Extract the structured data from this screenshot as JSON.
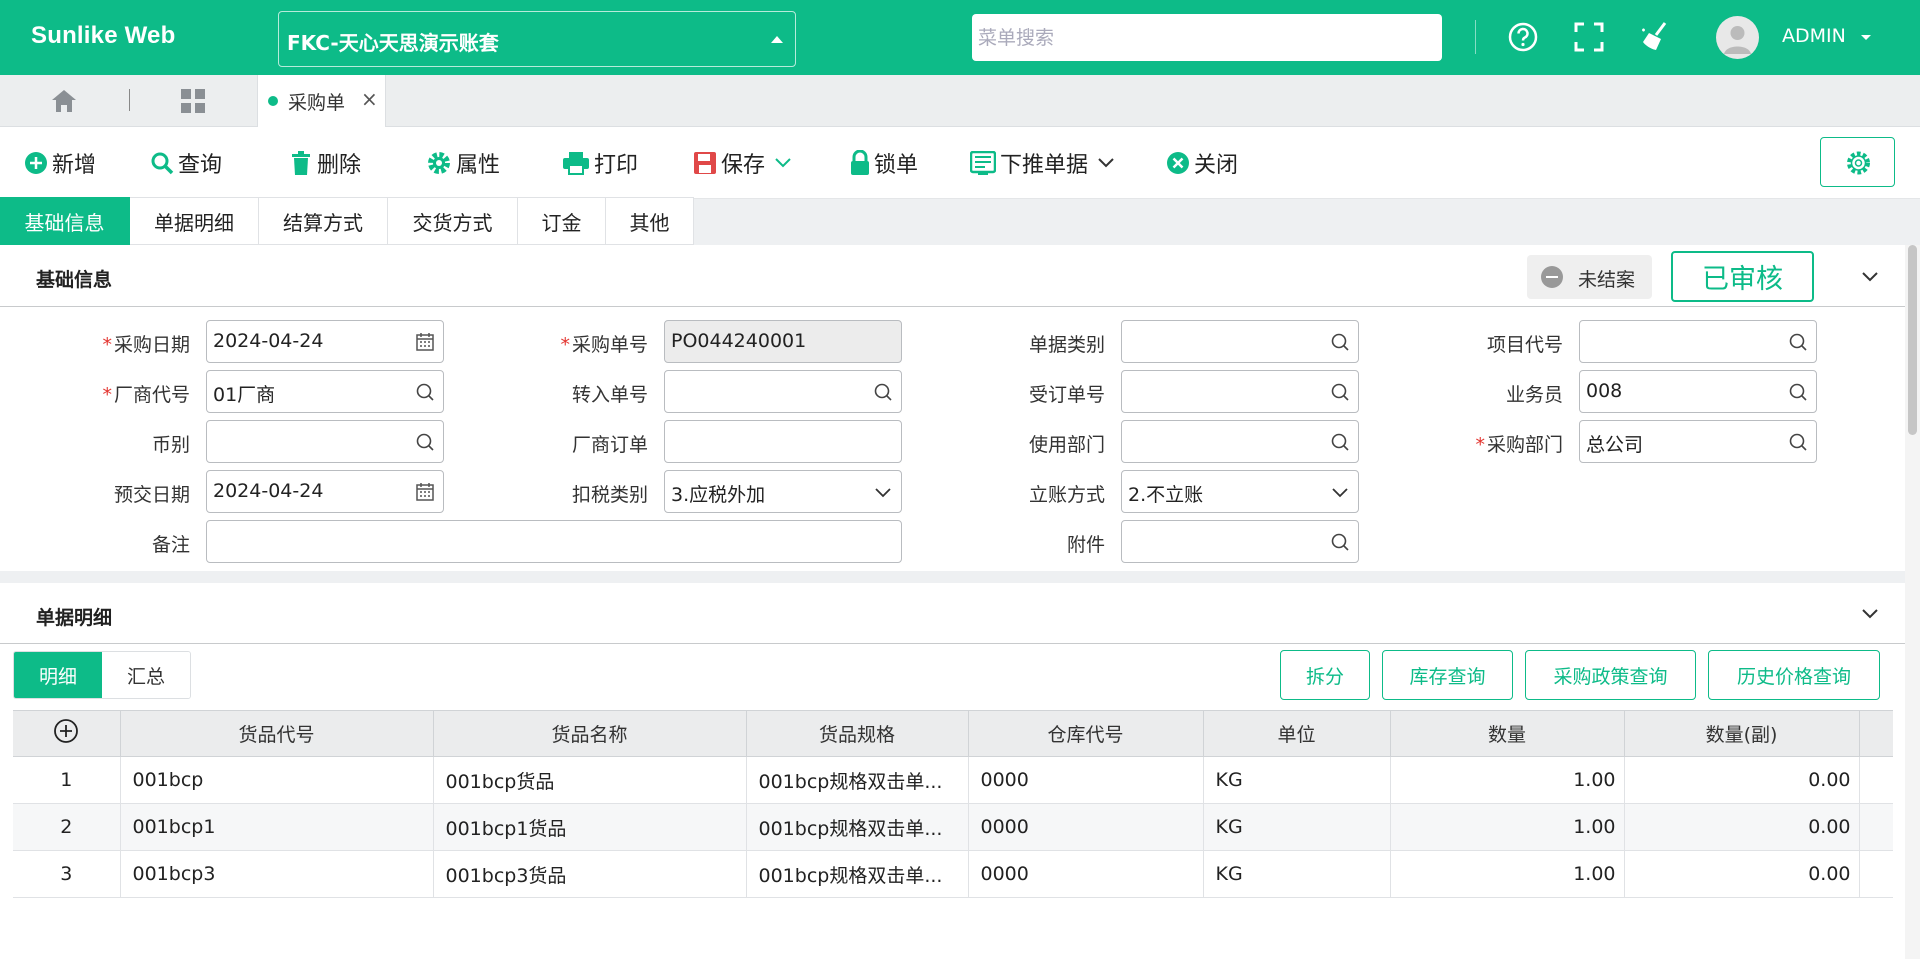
{
  "topbar": {
    "brand": "Sunlike Web",
    "account": "FKC-天心天思演示账套",
    "search_placeholder": "菜单搜索",
    "user": "ADMIN"
  },
  "tabstrip": {
    "open_tab": "采购单",
    "close_glyph": "×"
  },
  "toolbar": {
    "new": "新增",
    "query": "查询",
    "delete": "删除",
    "properties": "属性",
    "print": "打印",
    "save": "保存",
    "lock": "锁单",
    "push_down": "下推单据",
    "close": "关闭"
  },
  "section_tabs": [
    "基础信息",
    "单据明细",
    "结算方式",
    "交货方式",
    "订金",
    "其他"
  ],
  "base": {
    "title": "基础信息",
    "status_unclosed": "未结案",
    "status_audited": "已审核",
    "labels": {
      "purchase_date": "采购日期",
      "purchase_no": "采购单号",
      "doc_type": "单据类别",
      "project_code": "项目代号",
      "vendor_code": "厂商代号",
      "transfer_no": "转入单号",
      "order_no": "受订单号",
      "salesman": "业务员",
      "currency": "币别",
      "vendor_order": "厂商订单",
      "dept_used": "使用部门",
      "purchase_dept": "采购部门",
      "delivery_date": "预交日期",
      "tax_type": "扣税类别",
      "account_method": "立账方式",
      "remark": "备注",
      "attachment": "附件"
    },
    "values": {
      "purchase_date": "2024-04-24",
      "purchase_no": "PO044240001",
      "vendor_code": "01厂商",
      "salesman": "008",
      "purchase_dept": "总公司",
      "delivery_date": "2024-04-24",
      "tax_type": "3.应税外加",
      "account_method": "2.不立账"
    },
    "required_mark": "*"
  },
  "detail": {
    "title": "单据明细",
    "subtabs": [
      "明细",
      "汇总"
    ],
    "buttons": [
      "拆分",
      "库存查询",
      "采购政策查询",
      "历史价格查询"
    ],
    "columns": [
      "货品代号",
      "货品名称",
      "货品规格",
      "仓库代号",
      "单位",
      "数量",
      "数量(副)"
    ],
    "rows": [
      [
        "1",
        "001bcp",
        "001bcp货品",
        "001bcp规格双击单...",
        "0000",
        "KG",
        "1.00",
        "0.00"
      ],
      [
        "2",
        "001bcp1",
        "001bcp1货品",
        "001bcp规格双击单...",
        "0000",
        "KG",
        "1.00",
        "0.00"
      ],
      [
        "3",
        "001bcp3",
        "001bcp3货品",
        "001bcp规格双击单...",
        "0000",
        "KG",
        "1.00",
        "0.00"
      ]
    ]
  },
  "colors": {
    "accent": "#0dbb88",
    "required": "#e3342f",
    "save_icon": "#e04848"
  }
}
